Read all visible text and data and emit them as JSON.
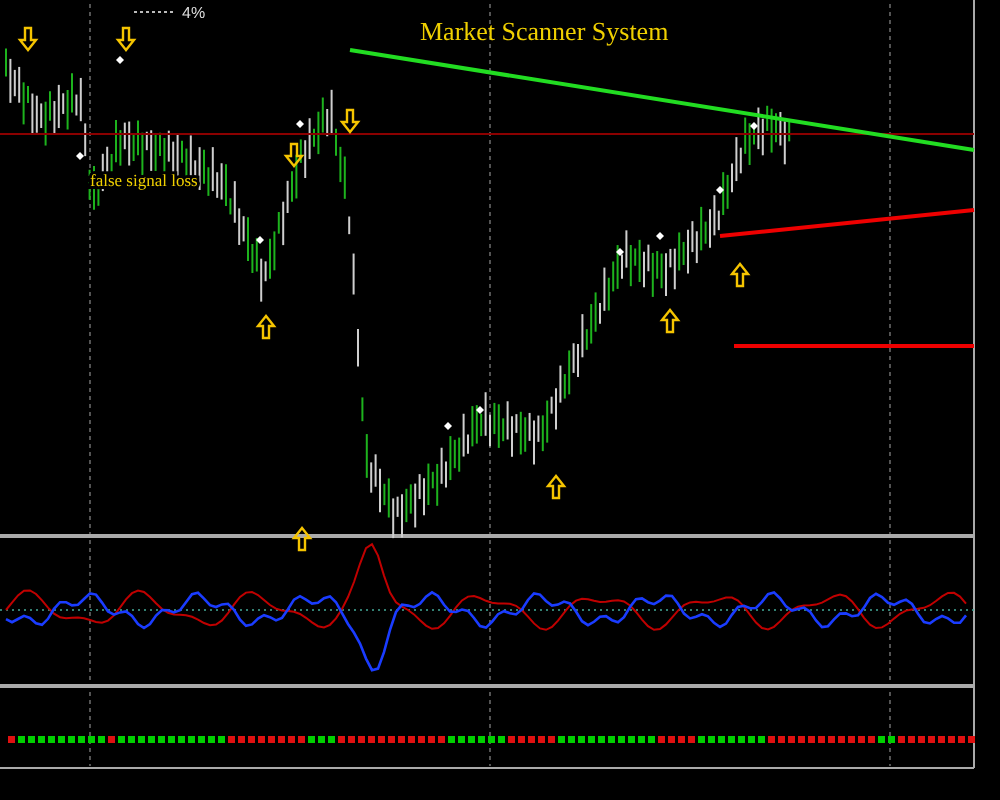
{
  "header": {
    "indicator_value": "4%"
  },
  "chart": {
    "title": "Market Scanner System",
    "annotation": "false signal loss"
  }
}
